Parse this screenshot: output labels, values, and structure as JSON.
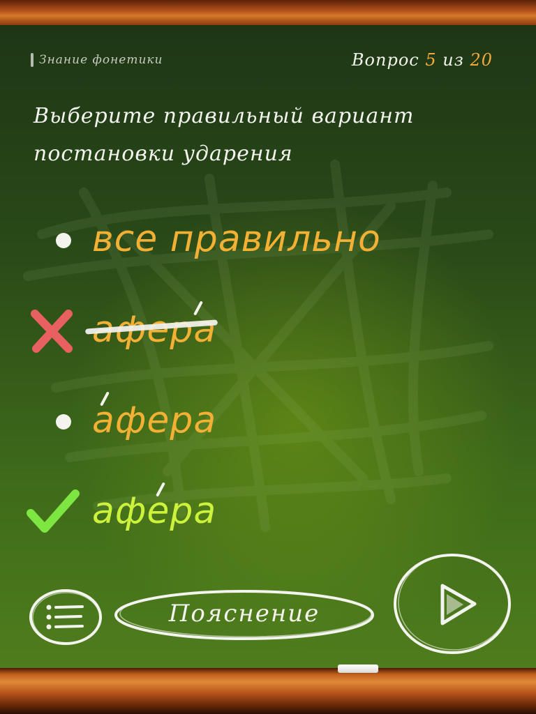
{
  "header": {
    "subject": "Знание фонетики",
    "counter_prefix": "Вопрос",
    "current": "5",
    "separator": "из",
    "total": "20"
  },
  "question": {
    "prompt_line1": "Выберите правильный вариант",
    "prompt_line2": "постановки ударения"
  },
  "answers": [
    {
      "text": "все правильно",
      "state": "neutral",
      "stressed_letter": ""
    },
    {
      "text": "афера",
      "state": "wrong",
      "stressed_letter": "а (последняя)"
    },
    {
      "text": "афера",
      "state": "neutral",
      "stressed_letter": "а (первая)"
    },
    {
      "text": "афера",
      "state": "correct",
      "stressed_letter": "е"
    }
  ],
  "footer": {
    "explain_label": "Пояснение"
  },
  "colors": {
    "board": "#2a4a18",
    "answer": "#f2b035",
    "correct": "#cdf23c",
    "wrong_mark": "#e86060",
    "check_mark": "#7ee640",
    "chalk": "#f4f4ee",
    "counter_number": "#f3a83a"
  },
  "icons": {
    "menu": "list-menu-icon",
    "next": "play-next-icon",
    "wrong": "cross-icon",
    "correct": "check-icon"
  }
}
